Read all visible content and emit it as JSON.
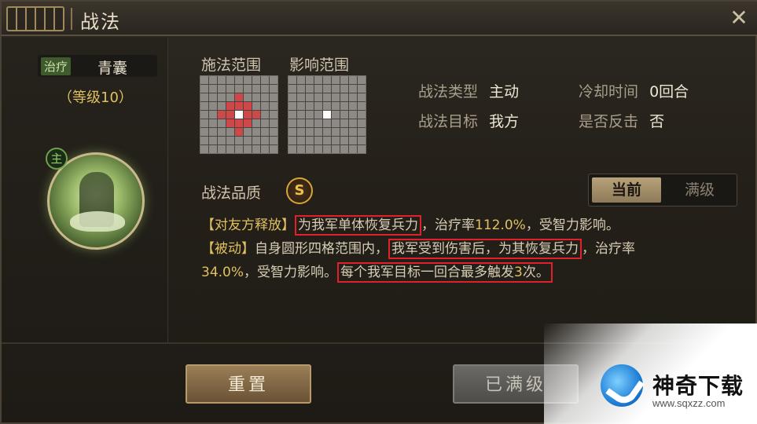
{
  "window": {
    "title": "战法",
    "close_glyph": "✕"
  },
  "hero": {
    "type_tag": "治疗",
    "name": "青囊",
    "level": "（等级10）",
    "main_badge": "主"
  },
  "cast_range": {
    "label": "施法范围"
  },
  "effect_range": {
    "label": "影响范围"
  },
  "stats": {
    "type_label": "战法类型",
    "type_value": "主动",
    "cooldown_label": "冷却时间",
    "cooldown_value": "0回合",
    "target_label": "战法目标",
    "target_value": "我方",
    "counter_label": "是否反击",
    "counter_value": "否"
  },
  "quality": {
    "label": "战法品质",
    "grade": "S"
  },
  "toggle": {
    "current": "当前",
    "max": "满级"
  },
  "description": {
    "line1_tag": "【对友方释放】",
    "line1_hl": "为我军单体恢复兵力",
    "line1_mid": "，治疗率",
    "line1_num": "112.0%",
    "line1_tail": "，受智力影响。",
    "line2_tag": "【被动】",
    "line2_text": "自身圆形四格范围内，",
    "line2_hl": "我军受到伤害后，为其恢复兵力",
    "line2_tail": "，治疗率",
    "line3_num": "34.0%",
    "line3_mid": "，受智力影响。",
    "line3_hl_a": "每个我军目标一回合最多触发",
    "line3_hl_num": "3",
    "line3_hl_b": "次。"
  },
  "buttons": {
    "reset": "重置",
    "maxed": "已满级"
  },
  "watermark": {
    "brand": "神奇下载",
    "url": "www.sqxzz.com"
  },
  "colors": {
    "accent_gold": "#e0c060",
    "highlight_red": "#e0202a",
    "grid_red": "#d0474a"
  }
}
